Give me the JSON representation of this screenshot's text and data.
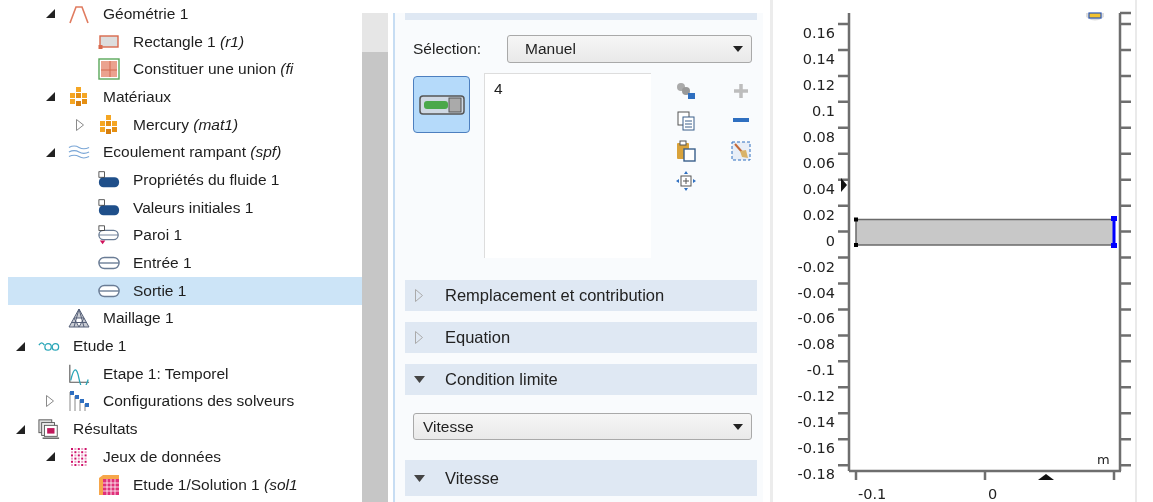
{
  "tree": [
    {
      "children": [
        {
          "label": "Géométrie 1",
          "kind": "geometry",
          "expanded": true,
          "selected": false,
          "children": [
            {
              "label": "Rectangle 1 *(r1)*",
              "kind": "rectangle",
              "selected": false
            },
            {
              "label": "Constituer une union *(fi*",
              "kind": "union",
              "selected": false
            }
          ]
        },
        {
          "label": "Matériaux",
          "kind": "materials",
          "expanded": true,
          "selected": false,
          "children": [
            {
              "label": "Mercury *(mat1)*",
              "kind": "materials",
              "expanded": false,
              "selected": false
            }
          ]
        },
        {
          "label": "Ecoulement rampant *(spf)*",
          "kind": "physics",
          "expanded": true,
          "selected": false,
          "children": [
            {
              "label": "Propriétés du fluide 1",
              "kind": "domain-feature",
              "selected": false
            },
            {
              "label": "Valeurs initiales 1",
              "kind": "domain-feature",
              "selected": false
            },
            {
              "label": "Paroi 1",
              "kind": "wall",
              "selected": false
            },
            {
              "label": "Entrée 1",
              "kind": "boundary",
              "selected": false
            },
            {
              "label": "Sortie 1",
              "kind": "boundary",
              "selected": true
            }
          ]
        },
        {
          "label": "Maillage 1",
          "kind": "mesh",
          "selected": false
        }
      ]
    },
    {
      "label": "Etude 1",
      "kind": "study",
      "expanded": true,
      "selected": false,
      "children": [
        {
          "label": "Etape 1: Temporel",
          "kind": "step",
          "selected": false
        },
        {
          "label": "Configurations des solveurs",
          "kind": "solver",
          "expanded": false,
          "selected": false
        }
      ]
    },
    {
      "label": "Résultats",
      "kind": "results",
      "expanded": true,
      "selected": false,
      "children": [
        {
          "label": "Jeux de données",
          "kind": "datasets",
          "expanded": true,
          "selected": false,
          "children": [
            {
              "label": "Etude 1/Solution 1 *(sol1*",
              "kind": "solution",
              "selected": false
            }
          ]
        }
      ]
    }
  ],
  "settings": {
    "selection": {
      "label": "Sélection:",
      "value": "Manuel"
    },
    "selection_toggle": {
      "active": true
    },
    "selection_list": [
      "4"
    ],
    "tools": [
      {
        "kind": "entities",
        "disabled": false
      },
      {
        "kind": "add",
        "disabled": true
      },
      {
        "kind": "copy",
        "disabled": false
      },
      {
        "kind": "remove",
        "disabled": false
      },
      {
        "kind": "paste",
        "disabled": false
      },
      {
        "kind": "clear",
        "disabled": false
      },
      {
        "kind": "zoom",
        "disabled": false
      }
    ],
    "sections": [
      {
        "title": "Remplacement et contribution",
        "expanded": false
      },
      {
        "title": "Equation",
        "expanded": false
      },
      {
        "title": "Condition limite",
        "expanded": true,
        "dropdown": "Vitesse"
      },
      {
        "title": "Vitesse",
        "expanded": true
      }
    ]
  },
  "graphics": {
    "y_ticks": [
      "0.16",
      "0.14",
      "0.12",
      "0.1",
      "0.08",
      "0.06",
      "0.04",
      "0.02",
      "0",
      "-0.02",
      "-0.04",
      "-0.06",
      "-0.08",
      "-0.1",
      "-0.12",
      "-0.14",
      "-0.16",
      "-0.18"
    ],
    "x_ticks": [
      "-0.1",
      "0"
    ],
    "unit": "m"
  }
}
